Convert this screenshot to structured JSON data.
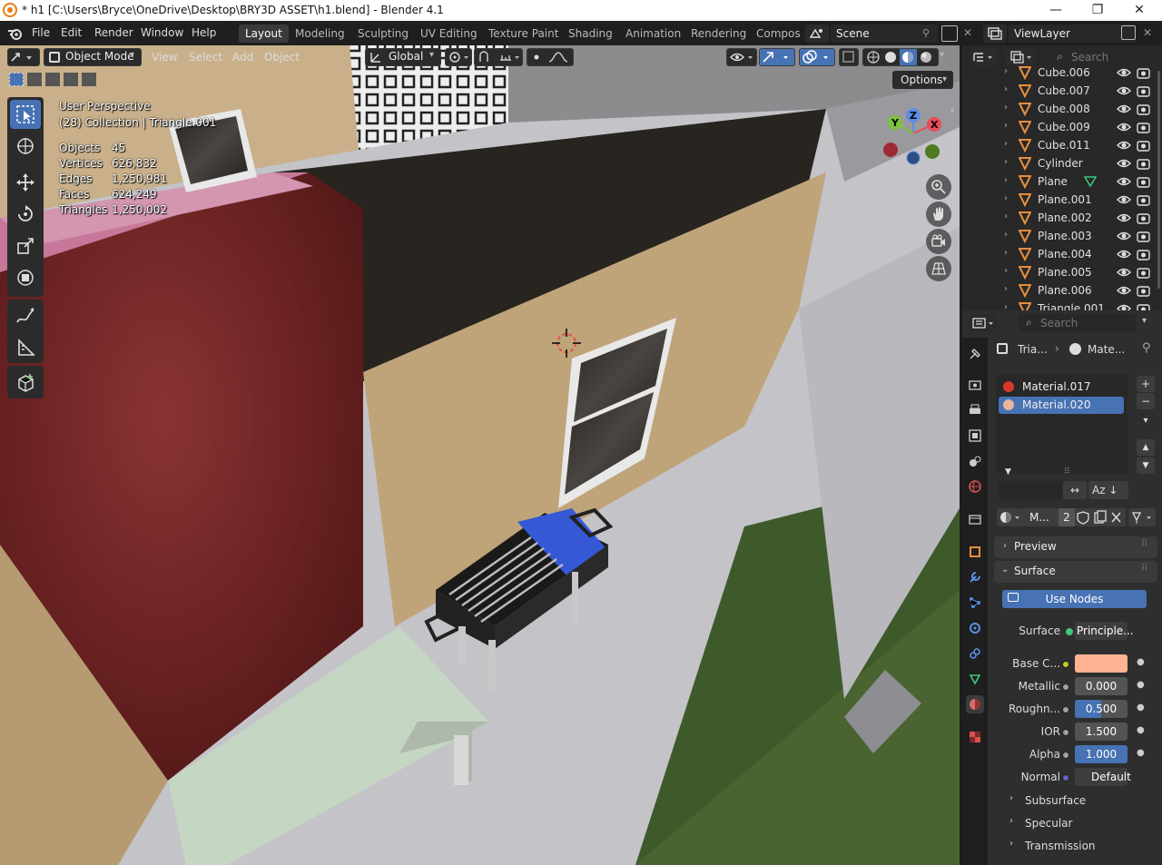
{
  "window": {
    "title": "* h1 [C:\\Users\\Bryce\\OneDrive\\Desktop\\BRY3D ASSET\\h1.blend] - Blender 4.1",
    "minimize": "—",
    "maximize": "❐",
    "close": "✕"
  },
  "menu": [
    "File",
    "Edit",
    "Render",
    "Window",
    "Help"
  ],
  "workspaces": [
    "Layout",
    "Modeling",
    "Sculpting",
    "UV Editing",
    "Texture Paint",
    "Shading",
    "Animation",
    "Rendering",
    "Compos"
  ],
  "active_workspace": "Layout",
  "scene": {
    "name": "Scene"
  },
  "view_layer": {
    "name": "ViewLayer"
  },
  "viewport_header": {
    "mode": "Object Mode",
    "menus": [
      "View",
      "Select",
      "Add",
      "Object"
    ],
    "orientation": "Global",
    "options": "Options"
  },
  "overlay": {
    "perspective": "User Perspective",
    "collection": "(28) Collection | Triangle.001",
    "stats": [
      {
        "label": "Objects",
        "value": "45"
      },
      {
        "label": "Vertices",
        "value": "626,832"
      },
      {
        "label": "Edges",
        "value": "1,250,981"
      },
      {
        "label": "Faces",
        "value": "624,249"
      },
      {
        "label": "Triangles",
        "value": "1,250,002"
      }
    ]
  },
  "gizmo": {
    "x": "X",
    "y": "Y",
    "z": "Z"
  },
  "outliner": {
    "search_placeholder": "Search",
    "items": [
      {
        "name": "Cube.006",
        "extra": ""
      },
      {
        "name": "Cube.007",
        "extra": ""
      },
      {
        "name": "Cube.008",
        "extra": ""
      },
      {
        "name": "Cube.009",
        "extra": ""
      },
      {
        "name": "Cube.011",
        "extra": ""
      },
      {
        "name": "Cylinder",
        "extra": ""
      },
      {
        "name": "Plane",
        "extra": "mesh"
      },
      {
        "name": "Plane.001",
        "extra": ""
      },
      {
        "name": "Plane.002",
        "extra": ""
      },
      {
        "name": "Plane.003",
        "extra": ""
      },
      {
        "name": "Plane.004",
        "extra": ""
      },
      {
        "name": "Plane.005",
        "extra": ""
      },
      {
        "name": "Plane.006",
        "extra": ""
      },
      {
        "name": "Triangle.001",
        "extra": ""
      }
    ]
  },
  "properties": {
    "search_placeholder": "Search",
    "breadcrumb_object": "Tria...",
    "breadcrumb_material": "Mate...",
    "material_slots": [
      {
        "name": "Material.017",
        "color": "#d9362b",
        "selected": false
      },
      {
        "name": "Material.020",
        "color": "#e8b49c",
        "selected": true
      }
    ],
    "material_name": "M...",
    "user_count": "2",
    "panels": {
      "preview": "Preview",
      "surface": "Surface",
      "use_nodes": "Use Nodes",
      "surface_label": "Surface",
      "surface_value": "Principle...",
      "base_color_label": "Base C...",
      "base_color": "#ffb393",
      "metallic_label": "Metallic",
      "metallic": "0.000",
      "roughness_label": "Roughn...",
      "roughness": "0.500",
      "roughness_fill": 0.5,
      "ior_label": "IOR",
      "ior": "1.500",
      "alpha_label": "Alpha",
      "alpha": "1.000",
      "alpha_fill": 1.0,
      "normal_label": "Normal",
      "normal": "Default",
      "subsurface": "Subsurface",
      "specular": "Specular",
      "transmission": "Transmission"
    }
  },
  "colors": {
    "accent": "#4772b3",
    "object_orange": "#e58e3f",
    "selected_row": "#4772b3"
  }
}
